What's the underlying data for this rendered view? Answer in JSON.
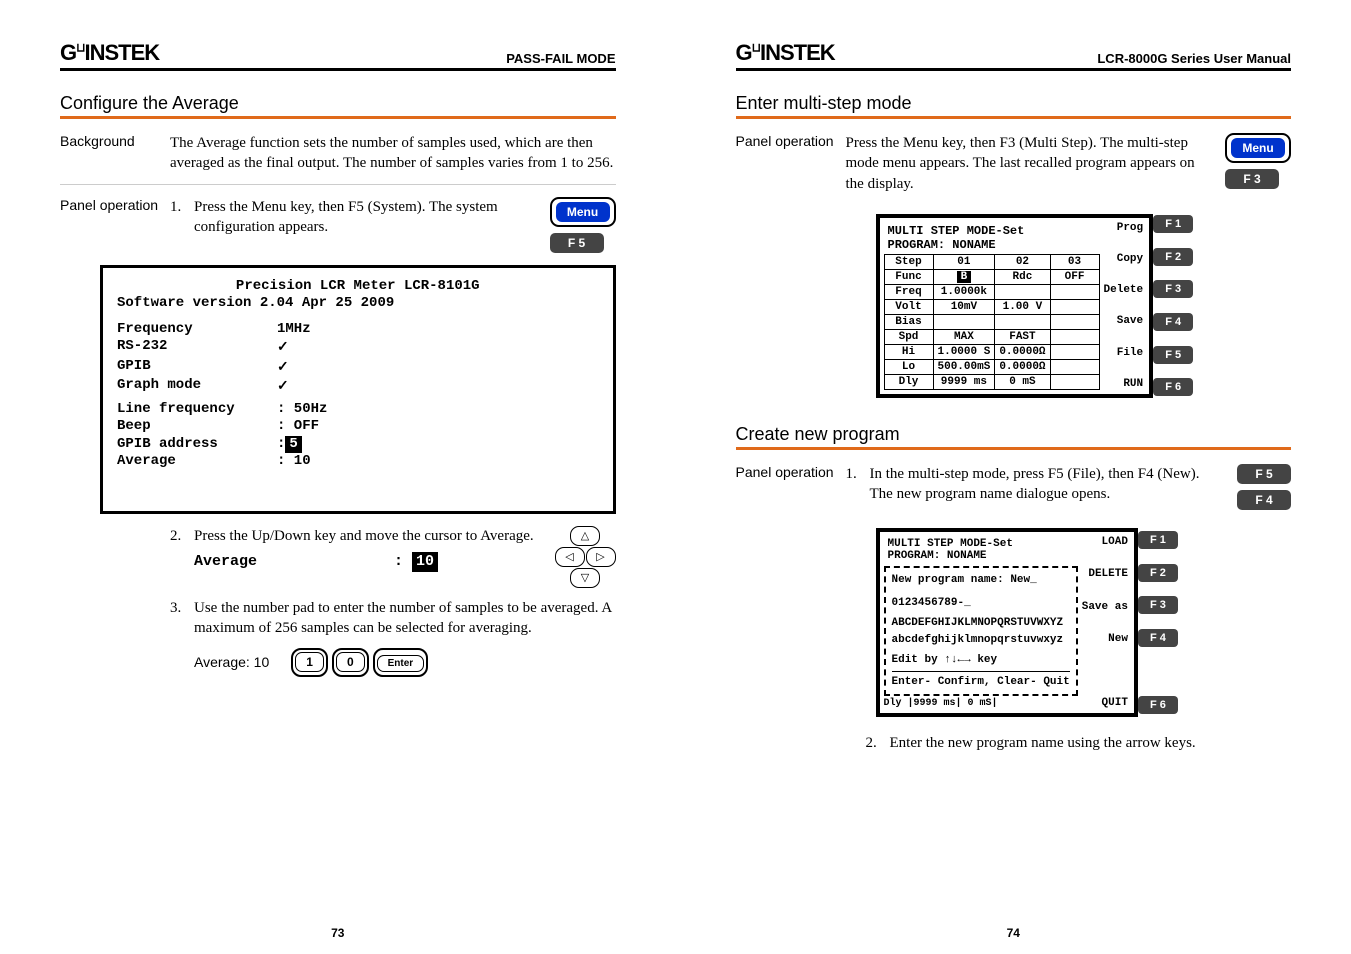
{
  "brand": "GWINSTEK",
  "left": {
    "headerTitle": "PASS-FAIL MODE",
    "section": "Configure the Average",
    "bgLabel": "Background",
    "bgText": "The Average function sets the number of samples used, which are then averaged as the final output. The number of samples varies from 1 to 256.",
    "poLabel": "Panel operation",
    "step1": "Press the Menu key, then F5 (System). The system configuration appears.",
    "menuKey": "Menu",
    "f5": "F 5",
    "screen": {
      "l1": "Precision LCR Meter LCR-8101G",
      "l2": "Software version 2.04 Apr 25 2009",
      "freqL": "Frequency",
      "freqV": "1MHz",
      "rsL": "RS-232",
      "gpibL": "GPIB",
      "gmL": "Graph mode",
      "lfL": "Line frequency",
      "lfV": ": 50Hz",
      "bpL": "Beep",
      "bpV": ": OFF",
      "gaL": "GPIB address",
      "gaV": ":",
      "gaHi": "5",
      "avL": "Average",
      "avV": ": 10"
    },
    "step2": "Press the Up/Down key and move the cursor to Average.",
    "avgLabel": "Average",
    "avgHi": "10",
    "step3": "Use the number pad to enter the number of samples to be averaged. A maximum of 256 samples can be selected for averaging.",
    "exLabel": "Average: 10",
    "k1": "1",
    "k0": "0",
    "kE": "Enter",
    "pageNum": "73"
  },
  "right": {
    "headerTitle": "LCR-8000G Series User Manual",
    "section1": "Enter multi-step mode",
    "poLabel": "Panel operation",
    "step1": "Press the Menu key, then F3 (Multi Step). The multi-step mode menu appears. The last recalled program appears on the display.",
    "menuKey": "Menu",
    "f3": "F 3",
    "ms": {
      "title1": "MULTI STEP MODE-Set",
      "title2": "PROGRAM: NONAME",
      "hdr": [
        "Step",
        "01",
        "02",
        "03"
      ],
      "rows": [
        [
          "Func",
          "B",
          "Rdc",
          "OFF"
        ],
        [
          "Freq",
          "1.0000k",
          "",
          ""
        ],
        [
          "Volt",
          "10mV",
          "1.00 V",
          ""
        ],
        [
          "Bias",
          "",
          "",
          ""
        ],
        [
          "Spd",
          "MAX",
          "FAST",
          ""
        ],
        [
          "Hi",
          "1.0000 S",
          "0.0000Ω",
          ""
        ],
        [
          "Lo",
          "500.00mS",
          "0.0000Ω",
          ""
        ],
        [
          "Dly",
          "9999 ms",
          "0 mS",
          ""
        ]
      ],
      "soft": [
        "Prog",
        "Copy",
        "Delete",
        "Save",
        "File",
        "RUN"
      ],
      "fk": [
        "F 1",
        "F 2",
        "F 3",
        "F 4",
        "F 5",
        "F 6"
      ]
    },
    "section2": "Create new program",
    "step2_1": "In the multi-step mode, press F5 (File), then F4 (New). The new program name dialogue opens.",
    "f5": "F 5",
    "f4": "F 4",
    "dlg": {
      "t1": "MULTI STEP MODE-Set",
      "t2": "PROGRAM: NONAME",
      "np": "New program name: New_",
      "digits": "0123456789-_",
      "upper": "ABCDEFGHIJKLMNOPQRSTUVWXYZ",
      "lower": "abcdefghijklmnopqrstuvwxyz",
      "edit": "Edit by ↑↓←→ key",
      "confirm": "Enter- Confirm, Clear- Quit",
      "bottom": "Dly |9999 ms|  0 mS|",
      "soft": [
        "LOAD",
        "DELETE",
        "Save as",
        "New",
        "",
        "QUIT"
      ],
      "fk": [
        "F 1",
        "F 2",
        "F 3",
        "F 4",
        "",
        "F 6"
      ]
    },
    "step2_2": "Enter the new program name using the arrow keys.",
    "pageNum": "74"
  }
}
